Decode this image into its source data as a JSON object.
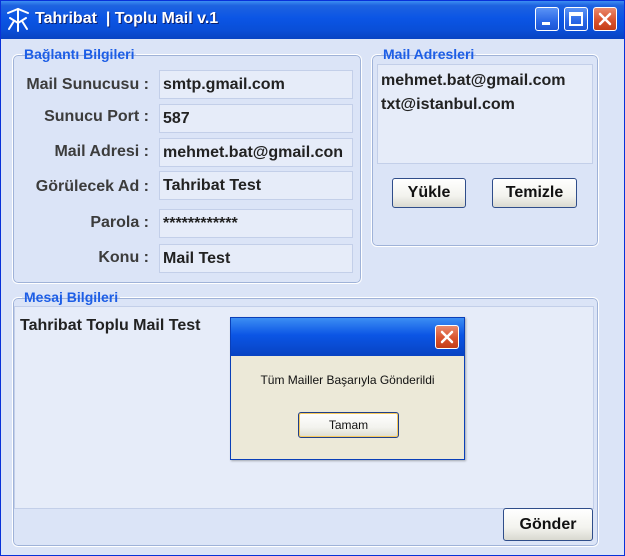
{
  "window": {
    "title": "Tahribat  | Toplu Mail v.1",
    "icon": "tahribat-logo-icon",
    "controls": [
      "minimize-icon",
      "maximize-icon",
      "close-icon"
    ]
  },
  "connection": {
    "legend": "Bağlantı Bilgileri",
    "fields": [
      {
        "label": "Mail Sunucusu :",
        "value": "smtp.gmail.com"
      },
      {
        "label": "Sunucu Port :",
        "value": "587"
      },
      {
        "label": "Mail Adresi :",
        "value": "mehmet.bat@gmail.con"
      },
      {
        "label": "Görülecek Ad :",
        "value": "Tahribat Test"
      },
      {
        "label": "Parola :",
        "value": "************"
      },
      {
        "label": "Konu :",
        "value": "Mail Test"
      }
    ]
  },
  "addresses": {
    "legend": "Mail Adresleri",
    "items": [
      "mehmet.bat@gmail.com",
      "txt@istanbul.com"
    ],
    "load_label": "Yükle",
    "clear_label": "Temizle"
  },
  "message": {
    "legend": "Mesaj Bilgileri",
    "body": "Tahribat Toplu Mail Test",
    "send_label": "Gönder"
  },
  "dialog": {
    "text": "Tüm Mailler Başarıyla Gönderildi",
    "ok_label": "Tamam"
  },
  "colors": {
    "titlebar": "#0b55e5",
    "legend": "#1d5ee6",
    "window_bg": "#dbe4f7",
    "field_bg": "#e6ecf9"
  }
}
